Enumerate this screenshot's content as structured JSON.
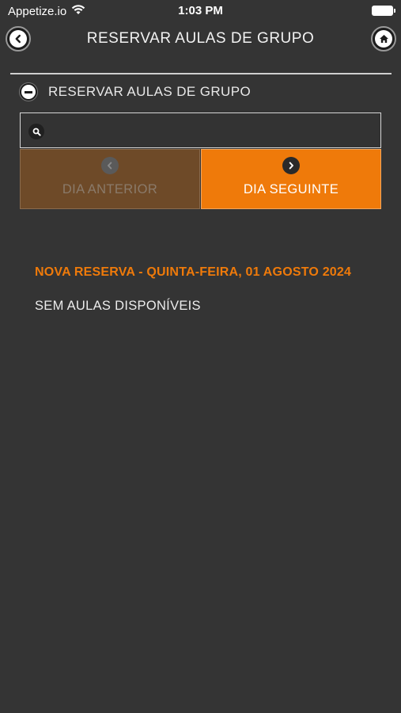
{
  "status_bar": {
    "carrier": "Appetize.io",
    "time": "1:03 PM"
  },
  "header": {
    "title": "RESERVAR AULAS DE GRUPO"
  },
  "section": {
    "title": "RESERVAR AULAS DE GRUPO"
  },
  "search": {
    "value": "",
    "placeholder": ""
  },
  "navigation": {
    "prev_label": "DIA ANTERIOR",
    "next_label": "DIA SEGUINTE"
  },
  "content": {
    "reservation_title": "NOVA RESERVA - QUINTA-FEIRA, 01 AGOSTO 2024",
    "empty_message": "SEM AULAS DISPONÍVEIS"
  },
  "colors": {
    "background": "#343434",
    "accent": "#ef7a0a",
    "prev_button": "#6e4a28"
  },
  "icons": {
    "wifi": "wifi-icon",
    "battery": "battery-icon",
    "back": "chevron-left-icon",
    "home": "home-icon",
    "collapse": "minus-circle-icon",
    "search": "search-icon",
    "prev": "chevron-left-icon",
    "next": "chevron-right-icon"
  }
}
